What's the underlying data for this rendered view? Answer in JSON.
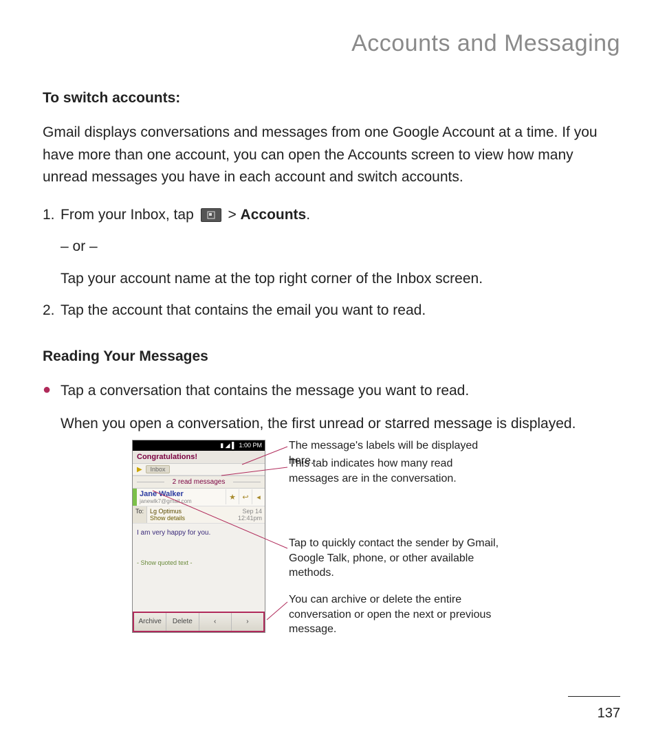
{
  "chapter_title": "Accounts and Messaging",
  "section1_heading": "To switch accounts:",
  "section1_para": "Gmail displays conversations and messages from one Google Account at a time. If you have more than one account, you can open the Accounts screen to view how many unread messages you have in each account and switch accounts.",
  "step1_num": "1.",
  "step1_pre": "From your Inbox, tap ",
  "step1_post_sep": " > ",
  "step1_post_bold": "Accounts",
  "step1_period": ".",
  "step1_or": "– or –",
  "step1_alt": "Tap your account name at the top right corner of the Inbox screen.",
  "step2_num": "2.",
  "step2_text": "Tap the account that contains the email you want to read.",
  "section2_heading": "Reading Your Messages",
  "bullet1": "Tap a conversation that contains the message you want to read.",
  "bullet1_after": "When you open a conversation, the first unread or starred message is displayed.",
  "phone": {
    "time": "1:00 PM",
    "subject": "Congratulations!",
    "inbox_label": "Inbox",
    "read_bar": "2 read messages",
    "sender_name": "Jane Walker",
    "sender_email": "janewlk7@gmail.com",
    "to_label": "To:",
    "to_value": "Lg Optimus",
    "show_details": "Show details",
    "date": "Sep 14",
    "time2": "12:41pm",
    "body_text": "I am very happy for you.",
    "quoted": "- Show quoted text -",
    "archive": "Archive",
    "delete": "Delete",
    "prev": "‹",
    "next": "›"
  },
  "annot1": "The message's labels will be displayed here.",
  "annot2": "This tab indicates how many read messages are in the conversation.",
  "annot3": "Tap to quickly contact the sender by Gmail, Google Talk, phone, or other available methods.",
  "annot4": "You can archive or delete the entire conversation or open the next or previous message.",
  "page_number": "137"
}
